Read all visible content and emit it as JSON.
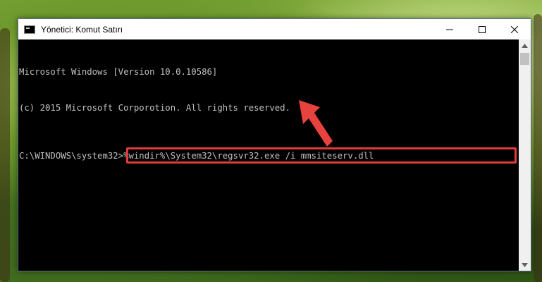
{
  "window": {
    "title": "Yönetici: Komut Satırı",
    "controls": [
      "minimize",
      "maximize",
      "close"
    ]
  },
  "console": {
    "lines": [
      "Microsoft Windows [Version 10.0.10586]",
      "(c) 2015 Microsoft Corporotion. All rights reserved."
    ],
    "prompt": "C:\\WINDOWS\\system32>",
    "command": "%windir%\\System32\\regsvr32.exe /i mmsiteserv.dll"
  },
  "colors": {
    "highlight": "#e03a3a",
    "console_text": "#c0c0c0",
    "console_bg": "#000000"
  },
  "annotation": {
    "arrow": "red-pointer-arrow"
  }
}
